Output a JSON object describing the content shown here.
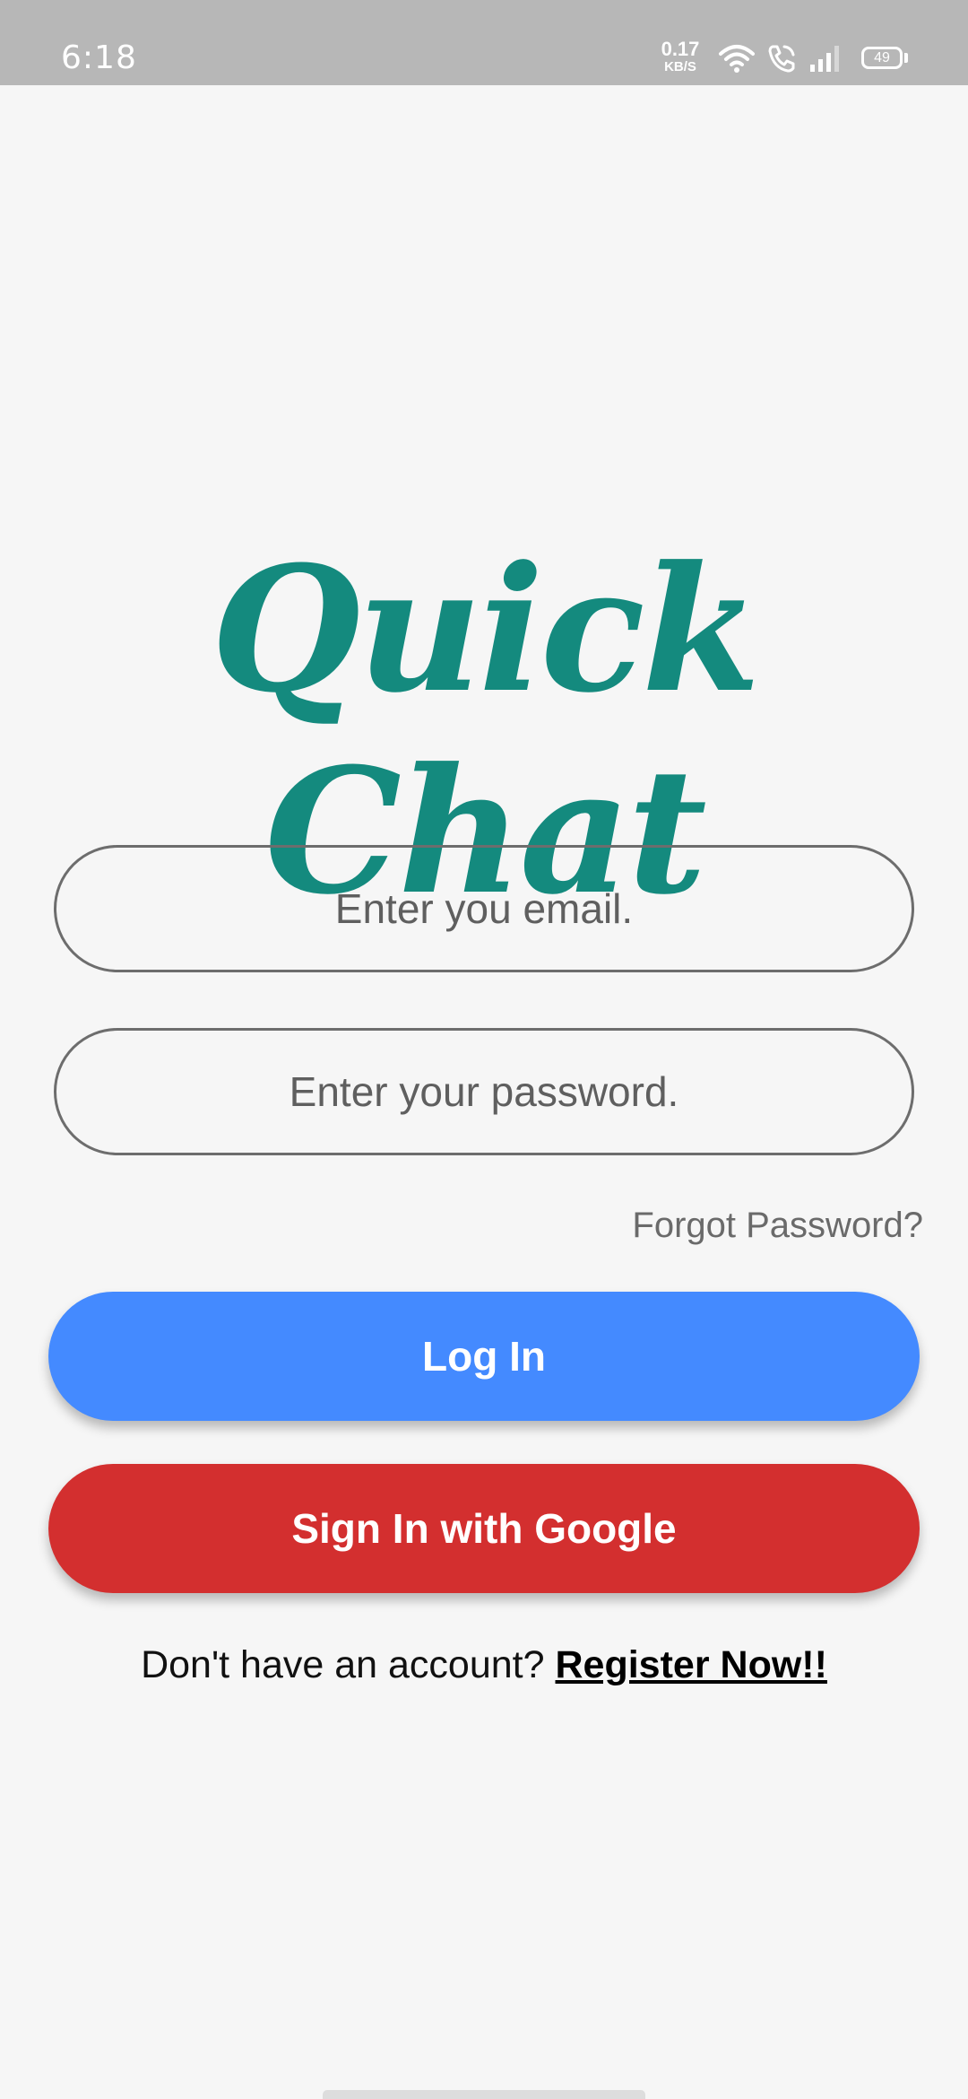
{
  "status_bar": {
    "time": "6:18",
    "net_speed_value": "0.17",
    "net_speed_unit": "KB/S",
    "battery": "49",
    "icons": [
      "wifi-icon",
      "call-icon",
      "signal-icon",
      "battery-icon"
    ]
  },
  "app": {
    "logo_text": "Quick Chat"
  },
  "login_form": {
    "email_placeholder": "Enter you email.",
    "email_value": "",
    "password_placeholder": "Enter your password.",
    "password_value": "",
    "forgot_password": "Forgot Password?",
    "login_label": "Log In",
    "google_label": "Sign In with Google",
    "register_prompt": "Don't have an account?",
    "register_link": "Register Now!!"
  },
  "colors": {
    "logo": "#148a7e",
    "login_button": "#448aff",
    "google_button": "#d32f2f",
    "status_bar": "#b7b7b7",
    "background": "#f6f6f6"
  }
}
